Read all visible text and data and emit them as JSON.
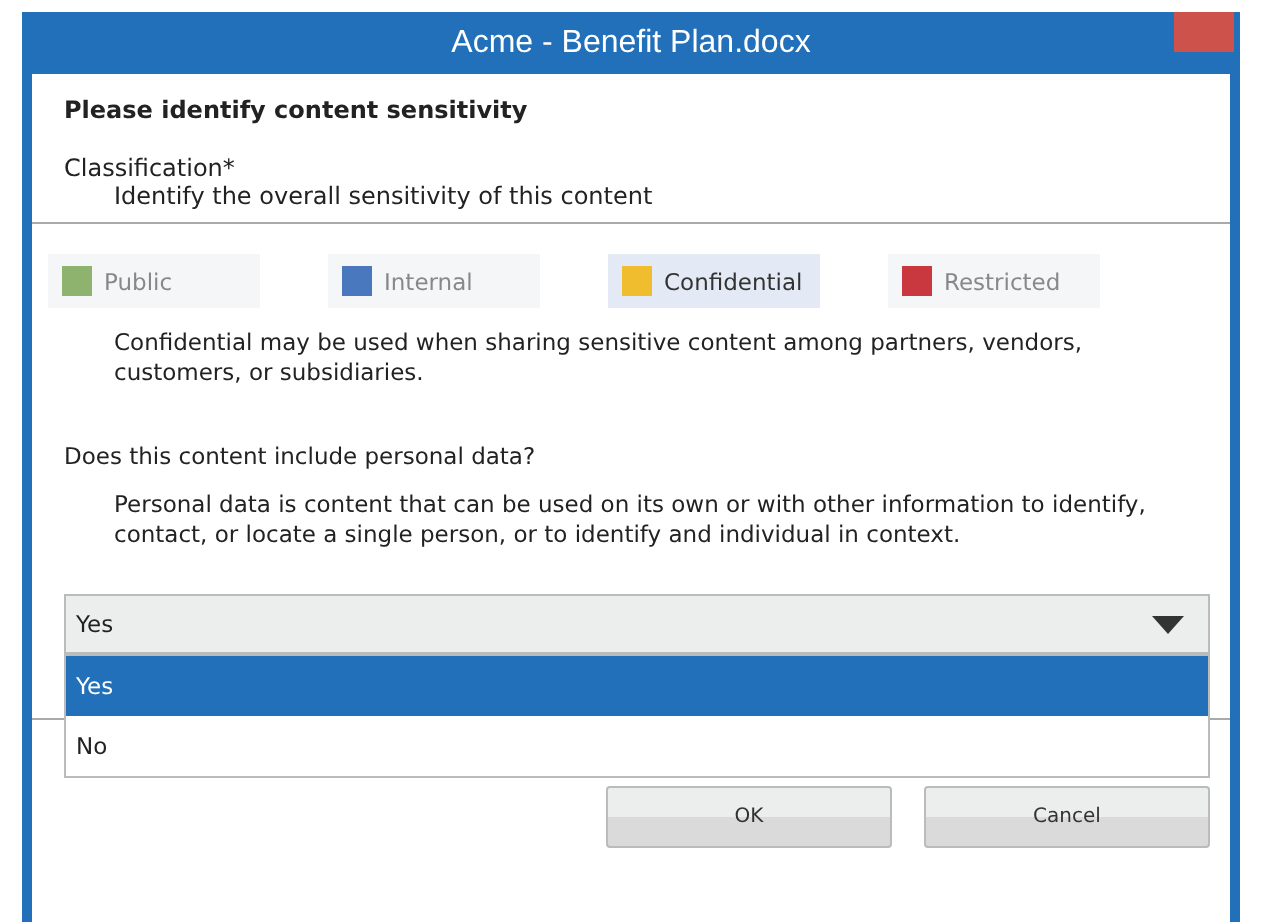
{
  "window": {
    "title": "Acme - Benefit Plan.docx"
  },
  "heading": "Please identify content sensitivity",
  "classification": {
    "label": "Classification*",
    "hint": "Identify the overall sensitivity of this content"
  },
  "levels": [
    {
      "label": "Public",
      "color": "#8db36e",
      "selected": false
    },
    {
      "label": "Internal",
      "color": "#4a78bf",
      "selected": false
    },
    {
      "label": "Confidential",
      "color": "#f0bd2f",
      "selected": true
    },
    {
      "label": "Restricted",
      "color": "#c9373f",
      "selected": false
    }
  ],
  "level_description": "Confidential may be used when sharing sensitive content among partners, vendors, customers, or subsidiaries.",
  "question": "Does this content include personal data?",
  "question_description": "Personal data is content that can be used on its own or with other information to identify, contact, or locate a single person, or to identify and individual in context.",
  "dropdown": {
    "value": "Yes",
    "expanded": true,
    "options": [
      {
        "label": "Yes",
        "selected": true
      },
      {
        "label": "No",
        "selected": false
      }
    ]
  },
  "buttons": [
    "OK",
    "Cancel"
  ]
}
